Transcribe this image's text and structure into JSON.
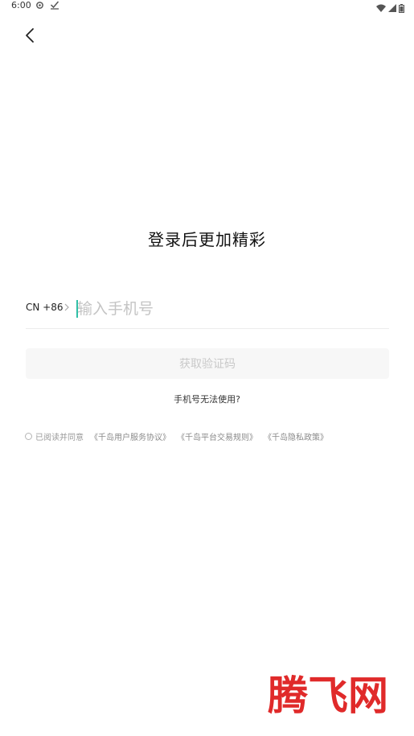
{
  "status_bar": {
    "time": "6:00"
  },
  "title": "登录后更加精彩",
  "phone": {
    "country_code": "CN +86",
    "placeholder": "输入手机号",
    "value": ""
  },
  "get_code_label": "获取验证码",
  "phone_unusable_label": "手机号无法使用?",
  "agreement": {
    "prefix": "已阅读并同意",
    "links": [
      "《千岛用户服务协议》",
      "《千岛平台交易规则》",
      "《千岛隐私政策》"
    ]
  },
  "watermark_text": "腾飞网",
  "colors": {
    "caret": "#2fbfa6",
    "watermark": "#e02a2a",
    "button_bg": "#f7f7f7",
    "button_text": "#c9c9c9"
  }
}
